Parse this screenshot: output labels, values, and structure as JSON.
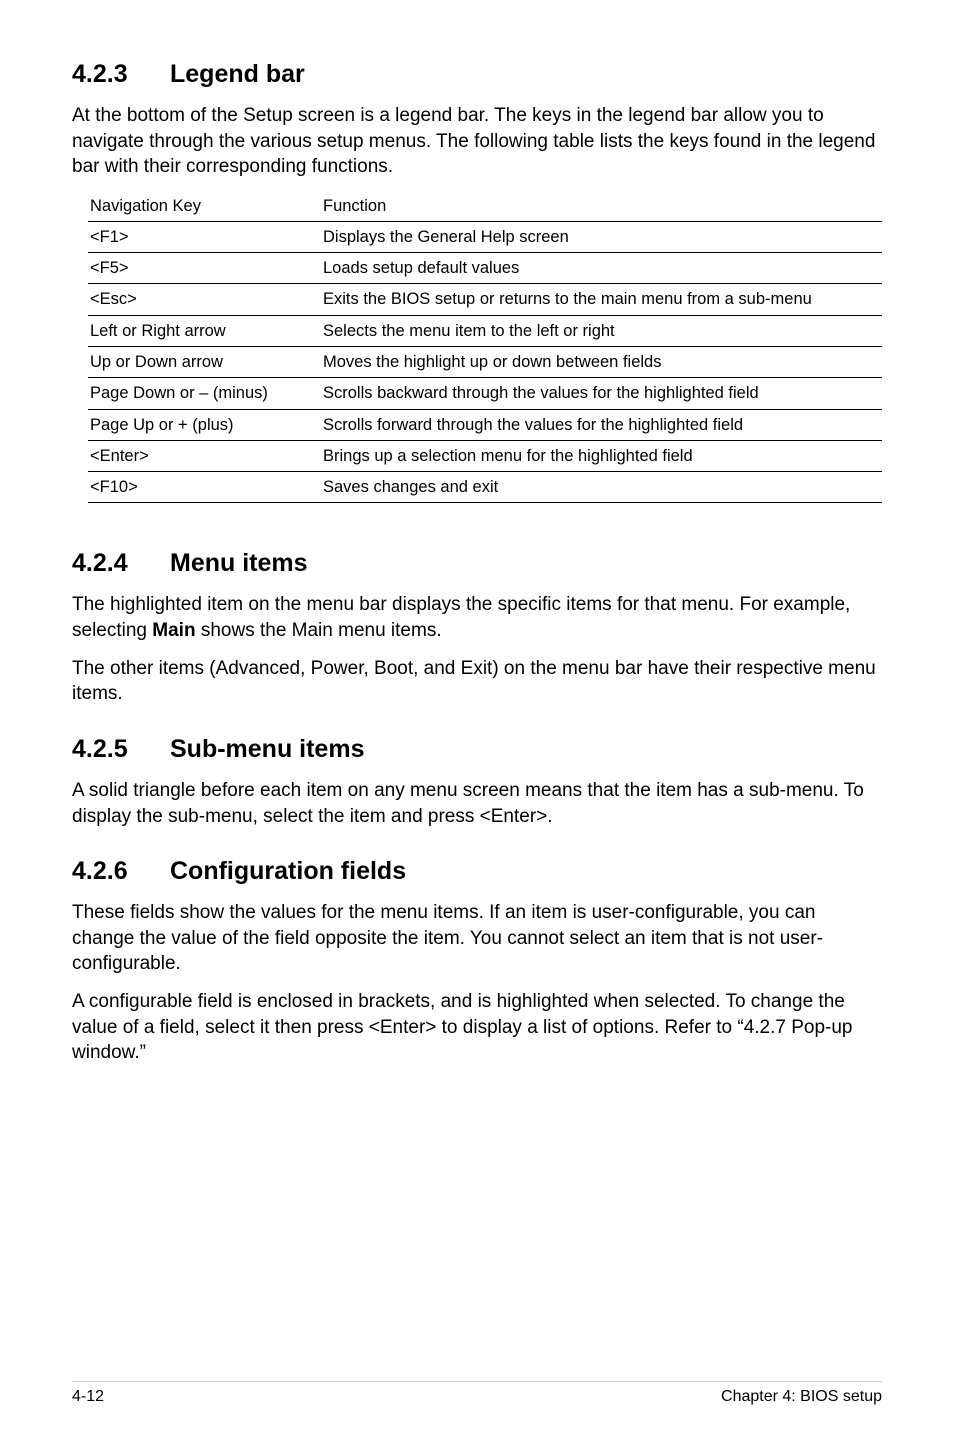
{
  "section1": {
    "num": "4.2.3",
    "title": "Legend bar",
    "intro": "At the bottom of the Setup screen is a legend bar. The keys in the legend bar allow you to navigate through the various setup menus. The following table lists the keys found in the legend bar with their corresponding functions.",
    "table": {
      "headers": [
        "Navigation Key",
        "Function"
      ],
      "rows": [
        [
          "<F1>",
          "Displays the General Help screen"
        ],
        [
          "<F5>",
          "Loads setup default values"
        ],
        [
          "<Esc>",
          "Exits the BIOS setup or returns to the main menu from a sub-menu"
        ],
        [
          "Left or Right arrow",
          "Selects the menu item to the left or right"
        ],
        [
          "Up or Down arrow",
          "Moves the highlight up or down between fields"
        ],
        [
          "Page Down or – (minus)",
          "Scrolls backward through the values for the highlighted field"
        ],
        [
          "Page Up or + (plus)",
          "Scrolls forward through the values for the highlighted field"
        ],
        [
          "<Enter>",
          "Brings up a selection menu for the highlighted field"
        ],
        [
          "<F10>",
          "Saves changes and exit"
        ]
      ]
    }
  },
  "section2": {
    "num": "4.2.4",
    "title": "Menu items",
    "p1a": "The highlighted item on the menu bar  displays the specific items for that menu. For example, selecting ",
    "p1bold": "Main",
    "p1b": " shows the Main menu items.",
    "p2": "The other items (Advanced, Power, Boot, and Exit) on the menu bar have their respective menu items."
  },
  "section3": {
    "num": "4.2.5",
    "title": "Sub-menu items",
    "p1": "A solid triangle before each item on any menu screen means that the item has a sub-menu. To display the sub-menu, select the item and press <Enter>."
  },
  "section4": {
    "num": "4.2.6",
    "title": "Configuration fields",
    "p1": "These fields show the values for the menu items. If an item is user-configurable, you can change the value of the field opposite the item. You cannot select an item that is not user-configurable.",
    "p2": "A configurable field is enclosed in brackets, and is highlighted when selected. To change the value of a field, select it then press <Enter> to display a list of options. Refer to “4.2.7 Pop-up window.”"
  },
  "footer": {
    "left": "4-12",
    "right": "Chapter 4: BIOS setup"
  }
}
